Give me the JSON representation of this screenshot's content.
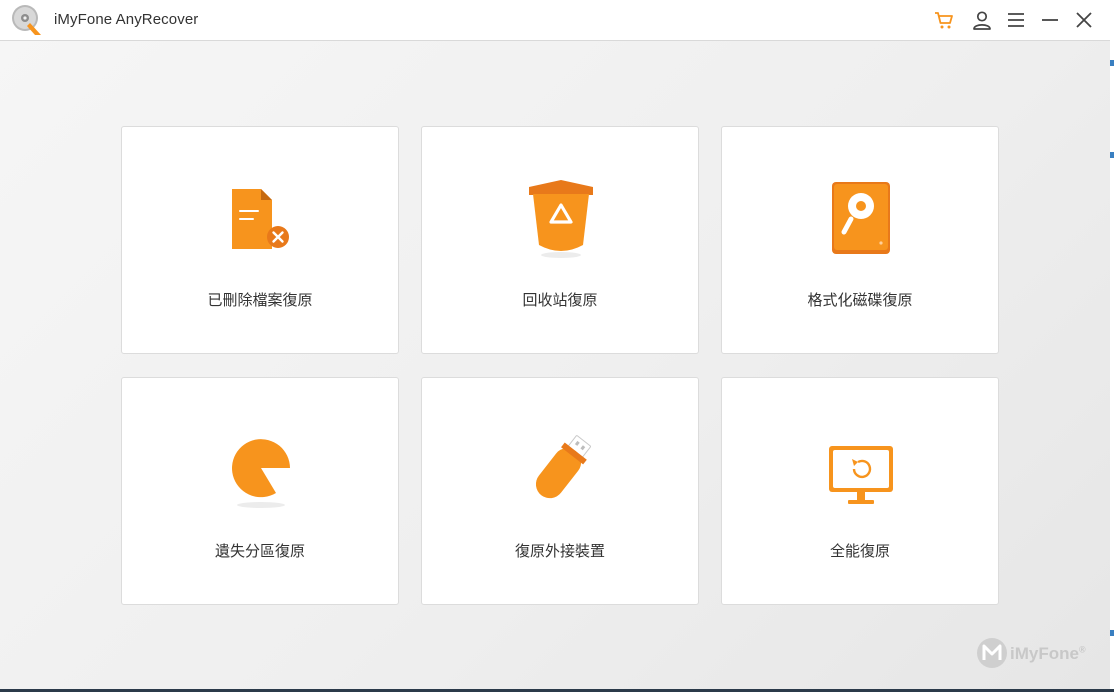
{
  "window": {
    "title": "iMyFone AnyRecover"
  },
  "titlebar_icons": [
    "cart-icon",
    "user-icon",
    "menu-icon",
    "minimize-icon",
    "close-icon"
  ],
  "colors": {
    "accent": "#f7941d",
    "accent_dark": "#e8791a",
    "text": "#333333"
  },
  "cards": [
    {
      "label": "已刪除檔案復原",
      "icon": "deleted-file-icon"
    },
    {
      "label": "回收站復原",
      "icon": "recycle-bin-icon"
    },
    {
      "label": "格式化磁碟復原",
      "icon": "formatted-disk-icon"
    },
    {
      "label": "遺失分區復原",
      "icon": "lost-partition-icon"
    },
    {
      "label": "復原外接裝置",
      "icon": "usb-drive-icon"
    },
    {
      "label": "全能復原",
      "icon": "all-round-recovery-icon"
    }
  ],
  "watermark": {
    "text": "iMyFone",
    "mark": "®"
  }
}
